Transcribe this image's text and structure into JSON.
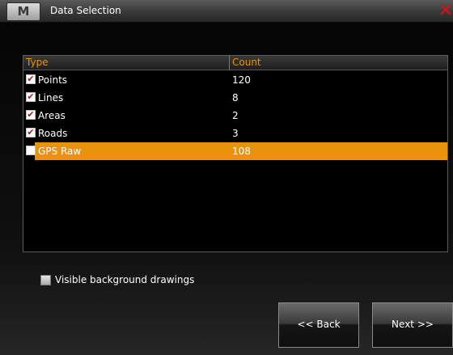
{
  "window": {
    "logo_letter": "M",
    "title": "Data Selection",
    "close_glyph": "✕"
  },
  "table": {
    "columns": {
      "type": "Type",
      "count": "Count"
    },
    "rows": [
      {
        "type": "Points",
        "count": "120",
        "checked": true,
        "selected": false
      },
      {
        "type": "Lines",
        "count": "8",
        "checked": true,
        "selected": false
      },
      {
        "type": "Areas",
        "count": "2",
        "checked": true,
        "selected": false
      },
      {
        "type": "Roads",
        "count": "3",
        "checked": true,
        "selected": false
      },
      {
        "type": "GPS Raw",
        "count": "108",
        "checked": false,
        "selected": true
      }
    ]
  },
  "options": {
    "background_drawings_label": "Visible background drawings",
    "background_drawings_checked": false
  },
  "buttons": {
    "back": "<< Back",
    "next": "Next >>"
  },
  "colors": {
    "accent": "#e8930b",
    "check_mark": "#b01a1a",
    "close": "#d71212"
  }
}
